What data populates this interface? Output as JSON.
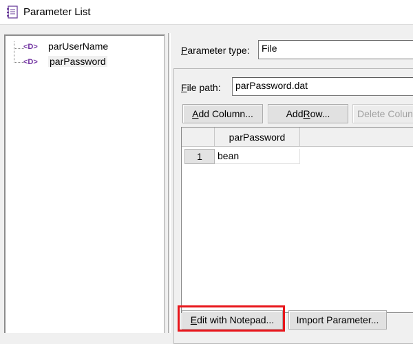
{
  "window": {
    "title": "Parameter List"
  },
  "tree": {
    "items": [
      {
        "label": "parUserName",
        "icon": "parameter-icon",
        "selected": false
      },
      {
        "label": "parPassword",
        "icon": "parameter-icon",
        "selected": true
      }
    ]
  },
  "parameter_type": {
    "label_prefix": "P",
    "label_rest": "arameter type:",
    "value": "File"
  },
  "file_path": {
    "label_prefix": "F",
    "label_rest": "ile path:",
    "value": "parPassword.dat"
  },
  "buttons": {
    "add_column": {
      "prefix": "A",
      "rest": "dd Column..."
    },
    "add_row": {
      "before": "Add ",
      "underline": "R",
      "after": "ow..."
    },
    "delete_column": {
      "label": "Delete Colun",
      "enabled": false
    },
    "edit_notepad": {
      "prefix": "E",
      "rest": "dit with Notepad..."
    },
    "import_parameter": {
      "label": "Import Parameter..."
    }
  },
  "grid": {
    "column_header": "parPassword",
    "rows": [
      {
        "num": "1",
        "value": "bean"
      }
    ]
  },
  "colors": {
    "highlight": "#e8161b",
    "icon_purple": "#7030a0"
  }
}
